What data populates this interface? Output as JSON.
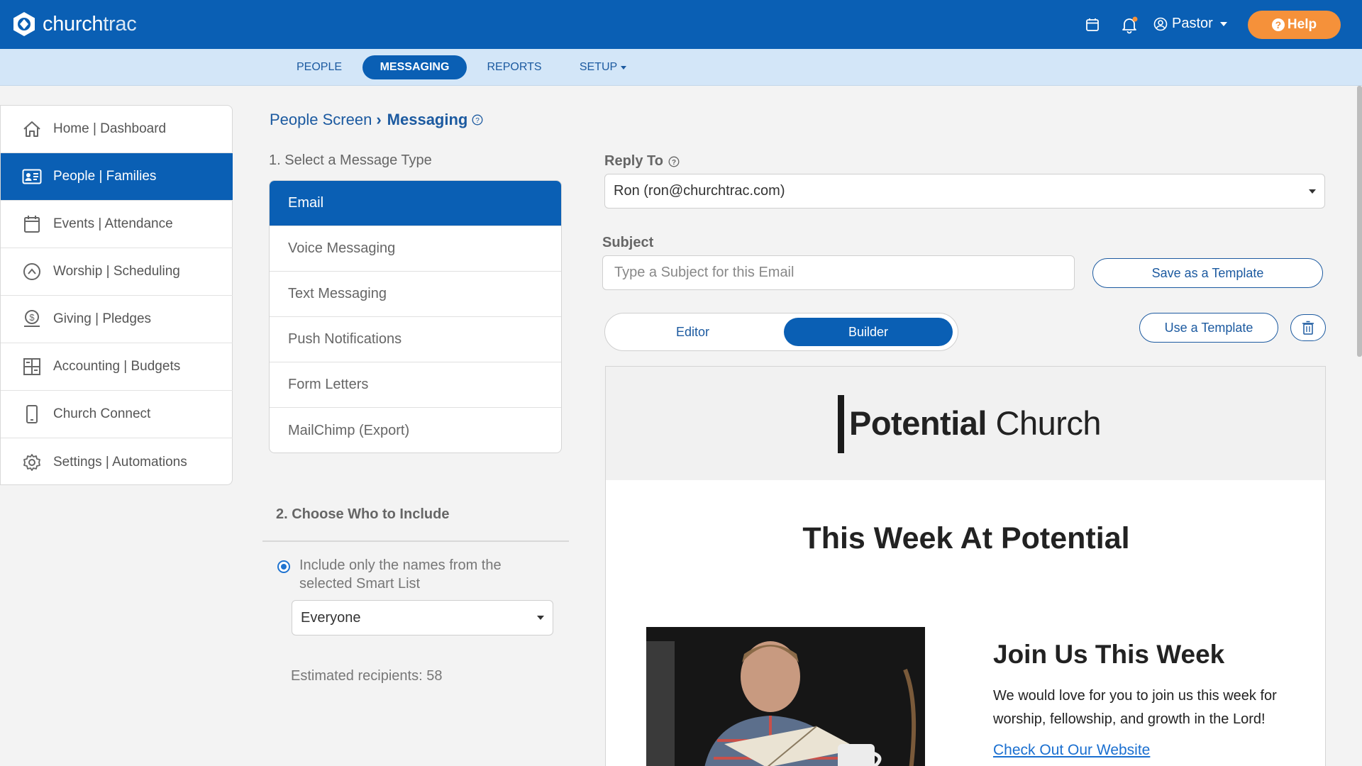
{
  "brand": {
    "name_part1": "church",
    "name_part2": "trac",
    "color": "#0a5fb4",
    "accent": "#f5913a"
  },
  "header": {
    "user_label": "Pastor",
    "help_label": "Help",
    "icons": [
      "calendar-icon",
      "bell-icon",
      "user-circle-icon"
    ]
  },
  "nav": {
    "tabs": [
      {
        "label": "PEOPLE"
      },
      {
        "label": "MESSAGING"
      },
      {
        "label": "REPORTS"
      },
      {
        "label": "SETUP"
      }
    ]
  },
  "sidebar": {
    "items": [
      {
        "label": "Home | Dashboard",
        "icon": "home-icon"
      },
      {
        "label": "People | Families",
        "icon": "id-card-icon"
      },
      {
        "label": "Events | Attendance",
        "icon": "calendar-icon"
      },
      {
        "label": "Worship | Scheduling",
        "icon": "chevron-circle-icon"
      },
      {
        "label": "Giving | Pledges",
        "icon": "money-icon"
      },
      {
        "label": "Accounting | Budgets",
        "icon": "grid-icon"
      },
      {
        "label": "Church Connect",
        "icon": "phone-icon"
      },
      {
        "label": "Settings | Automations",
        "icon": "gear-icon"
      }
    ]
  },
  "breadcrumb": {
    "parent": "People Screen",
    "current": "Messaging"
  },
  "message_type": {
    "heading": "1. Select a Message Type",
    "options": [
      "Email",
      "Voice Messaging",
      "Text Messaging",
      "Push Notifications",
      "Form Letters",
      "MailChimp (Export)"
    ]
  },
  "include": {
    "heading": "2. Choose Who to Include",
    "radio_label": "Include only the names from the selected Smart List",
    "smart_list_value": "Everyone",
    "estimate": "Estimated recipients: 58"
  },
  "reply_to": {
    "label": "Reply To",
    "value": "Ron (ron@churchtrac.com)"
  },
  "subject": {
    "label": "Subject",
    "placeholder": "Type a Subject for this Email",
    "save_template": "Save as a Template"
  },
  "mode": {
    "editor": "Editor",
    "builder": "Builder",
    "use_template": "Use a Template"
  },
  "preview": {
    "church_bold": "Potential",
    "church_regular": "Church",
    "title": "This Week At Potential",
    "join_title": "Join Us This Week",
    "join_text": "We would love for you to join us this week for worship, fellowship, and growth in the Lord!",
    "link_text": "Check Out Our Website"
  }
}
